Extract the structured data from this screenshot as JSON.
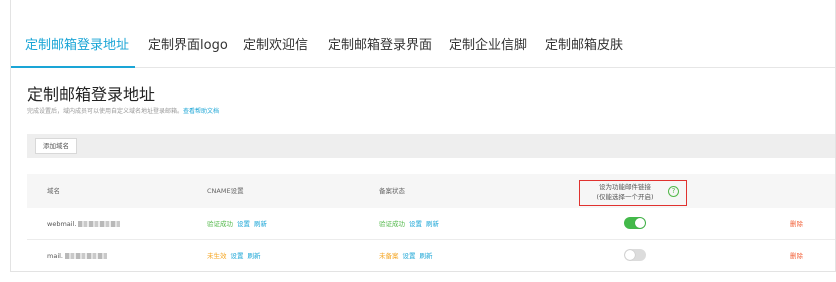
{
  "tabs": [
    {
      "label": "定制邮箱登录地址",
      "active": true
    },
    {
      "label": "定制界面logo",
      "active": false
    },
    {
      "label": "定制欢迎信",
      "active": false
    },
    {
      "label": "定制邮箱登录界面",
      "active": false
    },
    {
      "label": "定制企业信脚",
      "active": false
    },
    {
      "label": "定制邮箱皮肤",
      "active": false
    }
  ],
  "page": {
    "title": "定制邮箱登录地址",
    "hint": "完成设置后，域内成员可以使用自定义域名地址登录邮箱。",
    "help_link": "查看帮助文档"
  },
  "toolbar": {
    "add_domain_label": "添加域名"
  },
  "table": {
    "headers": {
      "domain": "域名",
      "cname": "CNAME设置",
      "filing": "备案状态",
      "feature_line1": "设为功能邮件链接",
      "feature_line2": "(仅能选择一个开启)",
      "feature_help_icon": "?"
    },
    "rows": [
      {
        "domain_prefix": "webmail.",
        "cname_status": "验证成功",
        "cname_status_kind": "ok",
        "filing_status": "验证成功",
        "filing_status_kind": "ok",
        "set_label": "设置",
        "refresh_label": "刷新",
        "feature_enabled": true,
        "delete_label": "删除"
      },
      {
        "domain_prefix": "mail.",
        "cname_status": "未生效",
        "cname_status_kind": "warn",
        "filing_status": "未备案",
        "filing_status_kind": "warn",
        "set_label": "设置",
        "refresh_label": "刷新",
        "feature_enabled": false,
        "delete_label": "删除"
      }
    ]
  },
  "colors": {
    "accent": "#1aa5d6",
    "success": "#52b84a",
    "warning": "#f5a623",
    "danger": "#f2623a",
    "highlight_box": "#e0322f"
  }
}
